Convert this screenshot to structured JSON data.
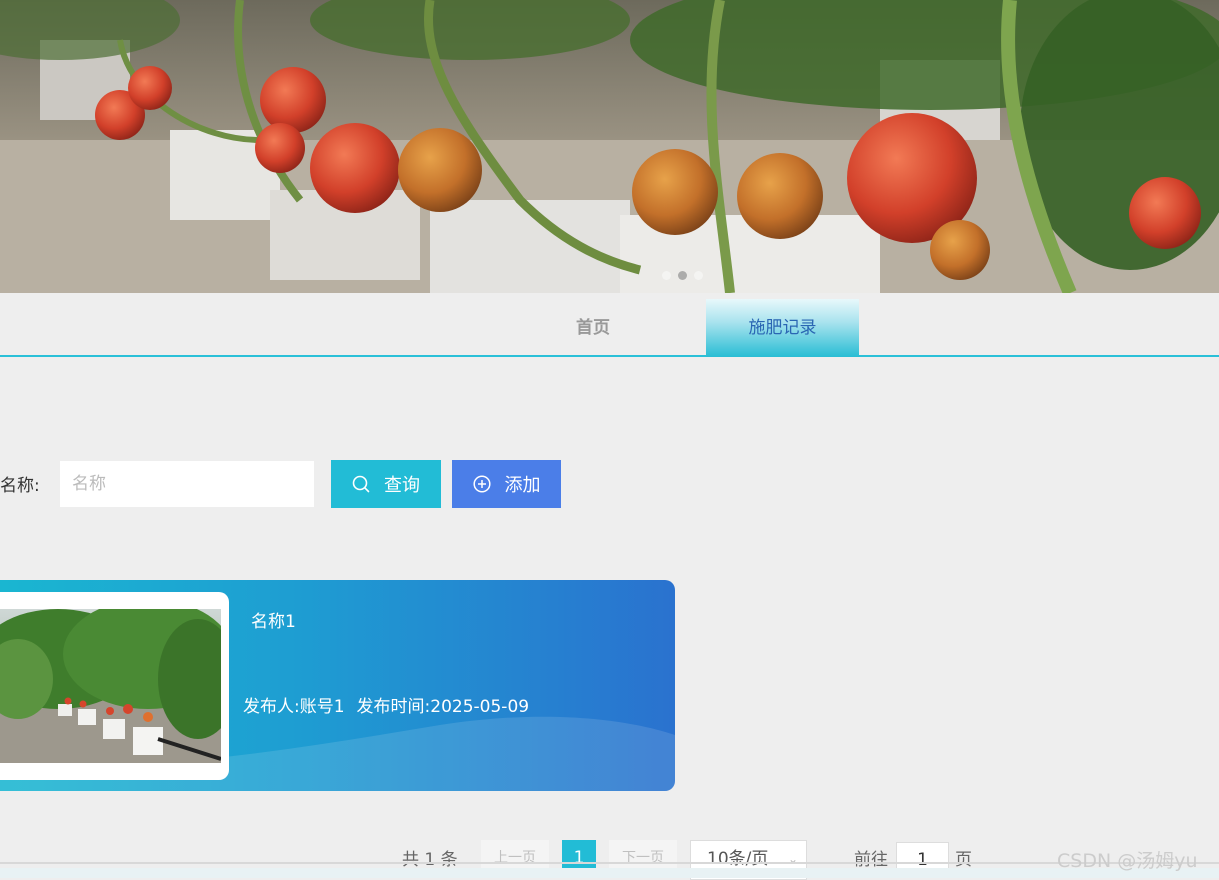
{
  "nav": {
    "items": [
      {
        "label": "首页"
      },
      {
        "label": "施肥记录"
      }
    ],
    "active_color": "#2ac0d8"
  },
  "search": {
    "label": "名称:",
    "placeholder": "名称",
    "value": "",
    "query_label": "查询",
    "add_label": "添加",
    "query_color": "#22bcd6",
    "add_color": "#4b7ee8"
  },
  "records": [
    {
      "title": "名称1",
      "publisher": "发布人:账号1",
      "publish_time": "发布时间:2025-05-09"
    }
  ],
  "pagination": {
    "total": "共 1 条",
    "prev": "上一页",
    "current_page": "1",
    "next": "下一页",
    "page_size": "10条/页",
    "goto": "前往",
    "goto_value": "1",
    "page_unit": "页"
  },
  "watermark": "CSDN @汤姆yu"
}
